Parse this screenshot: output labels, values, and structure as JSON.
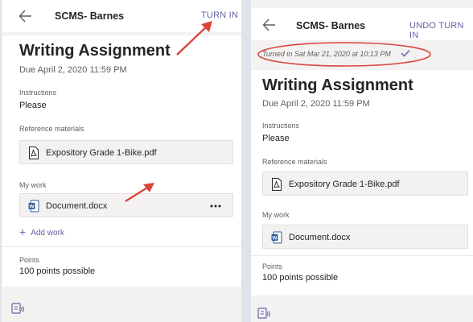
{
  "left": {
    "team_name": "SCMS- Barnes",
    "action": "TURN IN",
    "title": "Writing Assignment",
    "due": "Due April 2, 2020 11:59 PM",
    "instructions_label": "Instructions",
    "instructions_text": "Please",
    "reference_label": "Reference materials",
    "reference_file": "Expository Grade 1-Bike.pdf",
    "my_work_label": "My work",
    "work_file": "Document.docx",
    "add_work": "Add work",
    "points_label": "Points",
    "points_text": "100 points possible"
  },
  "right": {
    "team_name": "SCMS- Barnes",
    "action": "UNDO TURN IN",
    "status": "Turned in Sat Mar 21, 2020 at 10:13 PM",
    "title": "Writing Assignment",
    "due": "Due April 2, 2020 11:59 PM",
    "instructions_label": "Instructions",
    "instructions_text": "Please",
    "reference_label": "Reference materials",
    "reference_file": "Expository Grade 1-Bike.pdf",
    "my_work_label": "My work",
    "work_file": "Document.docx",
    "points_label": "Points",
    "points_text": "100 points possible"
  },
  "icons": {
    "back": "arrow-left-icon",
    "pdf": "pdf-file-icon",
    "word": "word-doc-icon",
    "more": "more-options-icon",
    "add": "plus-icon",
    "check": "checkmark-icon",
    "reader": "immersive-reader-icon"
  },
  "colors": {
    "accent": "#6264a7",
    "annotation_red": "#d9453b",
    "word_blue": "#2b579a"
  }
}
